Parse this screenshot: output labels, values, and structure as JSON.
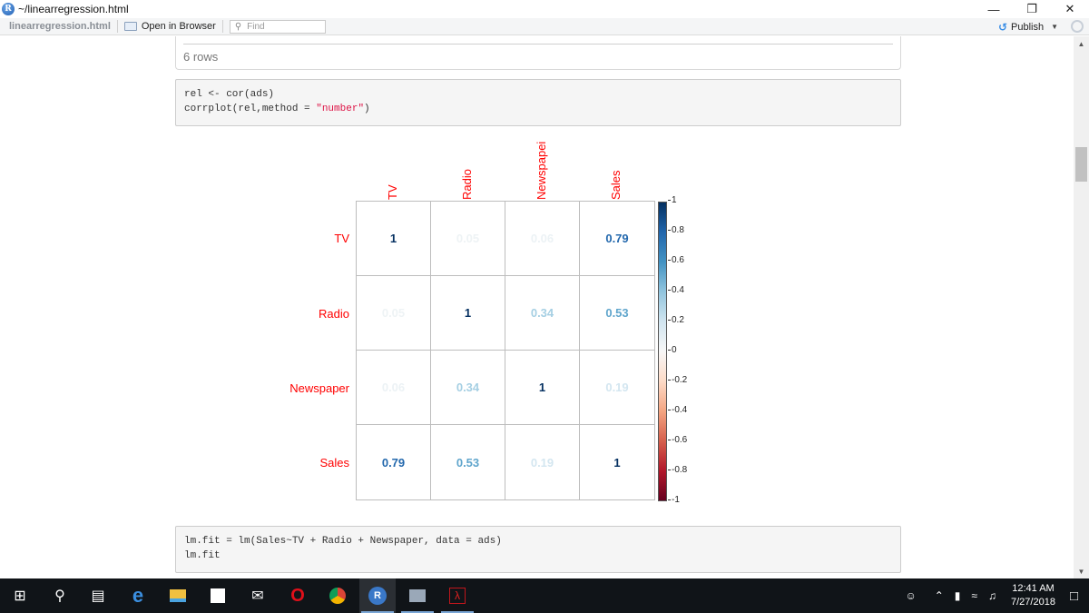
{
  "window": {
    "title": "~/linearregression.html",
    "app_logo": "R",
    "controls": {
      "minimize": "—",
      "restore": "❐",
      "close": "✕"
    }
  },
  "toolbar": {
    "filename": "linearregression.html",
    "open_in_browser": "Open in Browser",
    "find_placeholder": "Find",
    "publish": "Publish"
  },
  "content": {
    "table_footer": "6 rows",
    "code1": {
      "line1": "rel <- cor(ads)",
      "line2_prefix": "corrplot(rel,method = ",
      "line2_string": "\"number\"",
      "line2_suffix": ")"
    },
    "code2": {
      "line1": "lm.fit = lm(Sales~TV + Radio + Newspaper, data = ads)",
      "line2": "lm.fit"
    }
  },
  "chart_data": {
    "type": "heatmap",
    "method": "number",
    "variables": [
      "TV",
      "Radio",
      "Newspaper",
      "Sales"
    ],
    "col_labels_displayed": [
      "TV",
      "Radio",
      "Newspapei",
      "Sales"
    ],
    "matrix": [
      [
        1,
        0.05,
        0.06,
        0.79
      ],
      [
        0.05,
        1,
        0.34,
        0.53
      ],
      [
        0.06,
        0.34,
        1,
        0.19
      ],
      [
        0.79,
        0.53,
        0.19,
        1
      ]
    ],
    "colorbar": {
      "range": [
        -1,
        1
      ],
      "ticks": [
        "1",
        "0.8",
        "0.6",
        "0.4",
        "0.2",
        "0",
        "-0.2",
        "-0.4",
        "-0.6",
        "-0.8",
        "-1"
      ],
      "palette": [
        "#67001f",
        "#b2182b",
        "#d6604d",
        "#f4a582",
        "#fddbc7",
        "#f7f7f7",
        "#d1e5f0",
        "#92c5de",
        "#4393c3",
        "#2166ac",
        "#053061"
      ]
    },
    "label_color": "#ff0000"
  },
  "taskbar": {
    "apps": [
      "windows-start",
      "search",
      "task-view",
      "edge",
      "file-explorer",
      "store",
      "mail",
      "opera",
      "chrome",
      "rstudio",
      "network-monitor",
      "acrobat"
    ],
    "time": "12:41 AM",
    "date": "7/27/2018"
  }
}
